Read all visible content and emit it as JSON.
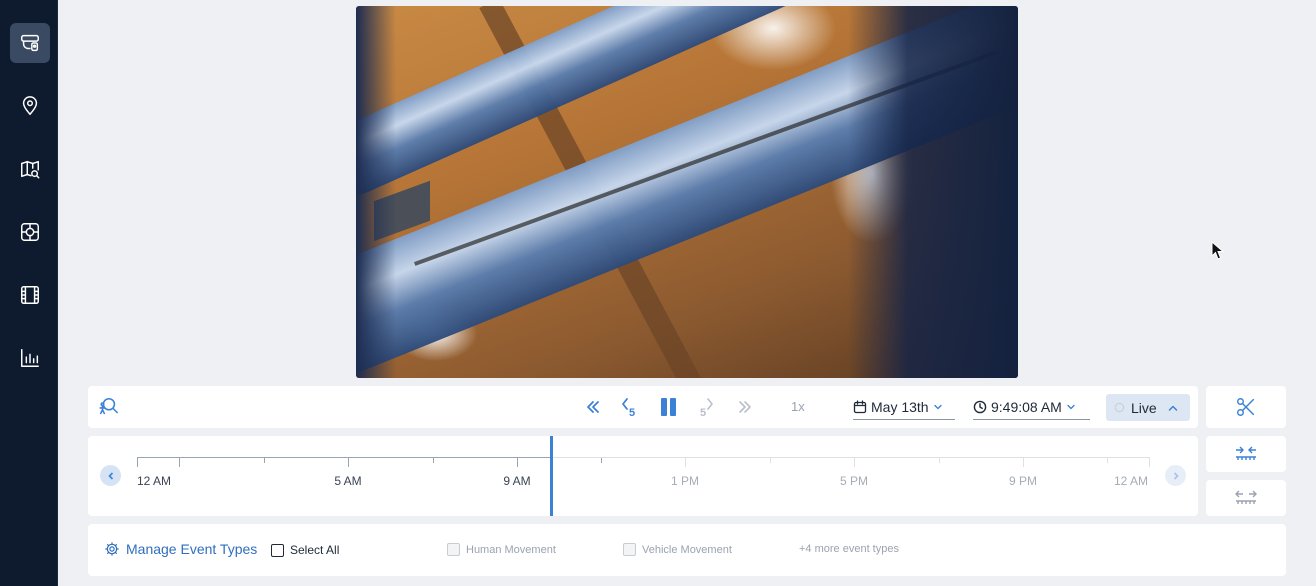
{
  "sidebar": {
    "items": [
      {
        "name": "cameras",
        "icon": "camera-icon",
        "active": true
      },
      {
        "name": "locations",
        "icon": "location-pin-icon",
        "active": false
      },
      {
        "name": "map-search",
        "icon": "map-search-icon",
        "active": false
      },
      {
        "name": "access",
        "icon": "access-control-icon",
        "active": false
      },
      {
        "name": "clips",
        "icon": "film-icon",
        "active": false
      },
      {
        "name": "reports",
        "icon": "bar-chart-icon",
        "active": false
      }
    ]
  },
  "controls": {
    "person_search_icon": "person-search-icon",
    "rewind_icon": "double-chevron-left-icon",
    "back5_label": "5",
    "pause_icon": "pause-icon",
    "forward5_label": "5",
    "fastforward_icon": "double-chevron-right-icon",
    "speed": "1x",
    "date": "May 13th",
    "time": "9:49:08 AM",
    "live_label": "Live",
    "scissors_icon": "scissors-icon",
    "zoom_in_icon": "timeline-zoom-in-icon",
    "zoom_out_icon": "timeline-zoom-out-icon"
  },
  "timeline": {
    "labels": [
      "12 AM",
      "5 AM",
      "9 AM",
      "1 PM",
      "5 PM",
      "9 PM",
      "12 AM"
    ],
    "future_labels": [
      "1 PM",
      "5 PM",
      "9 PM",
      "12 AM"
    ]
  },
  "events": {
    "manage_label": "Manage Event Types",
    "select_all_label": "Select All",
    "human_label": "Human Movement",
    "vehicle_label": "Vehicle Movement",
    "more_label": "+4 more event types"
  },
  "colors": {
    "accent": "#3b82d6",
    "sidebar_bg": "#0e1a2e",
    "main_bg": "#eff0f3"
  }
}
